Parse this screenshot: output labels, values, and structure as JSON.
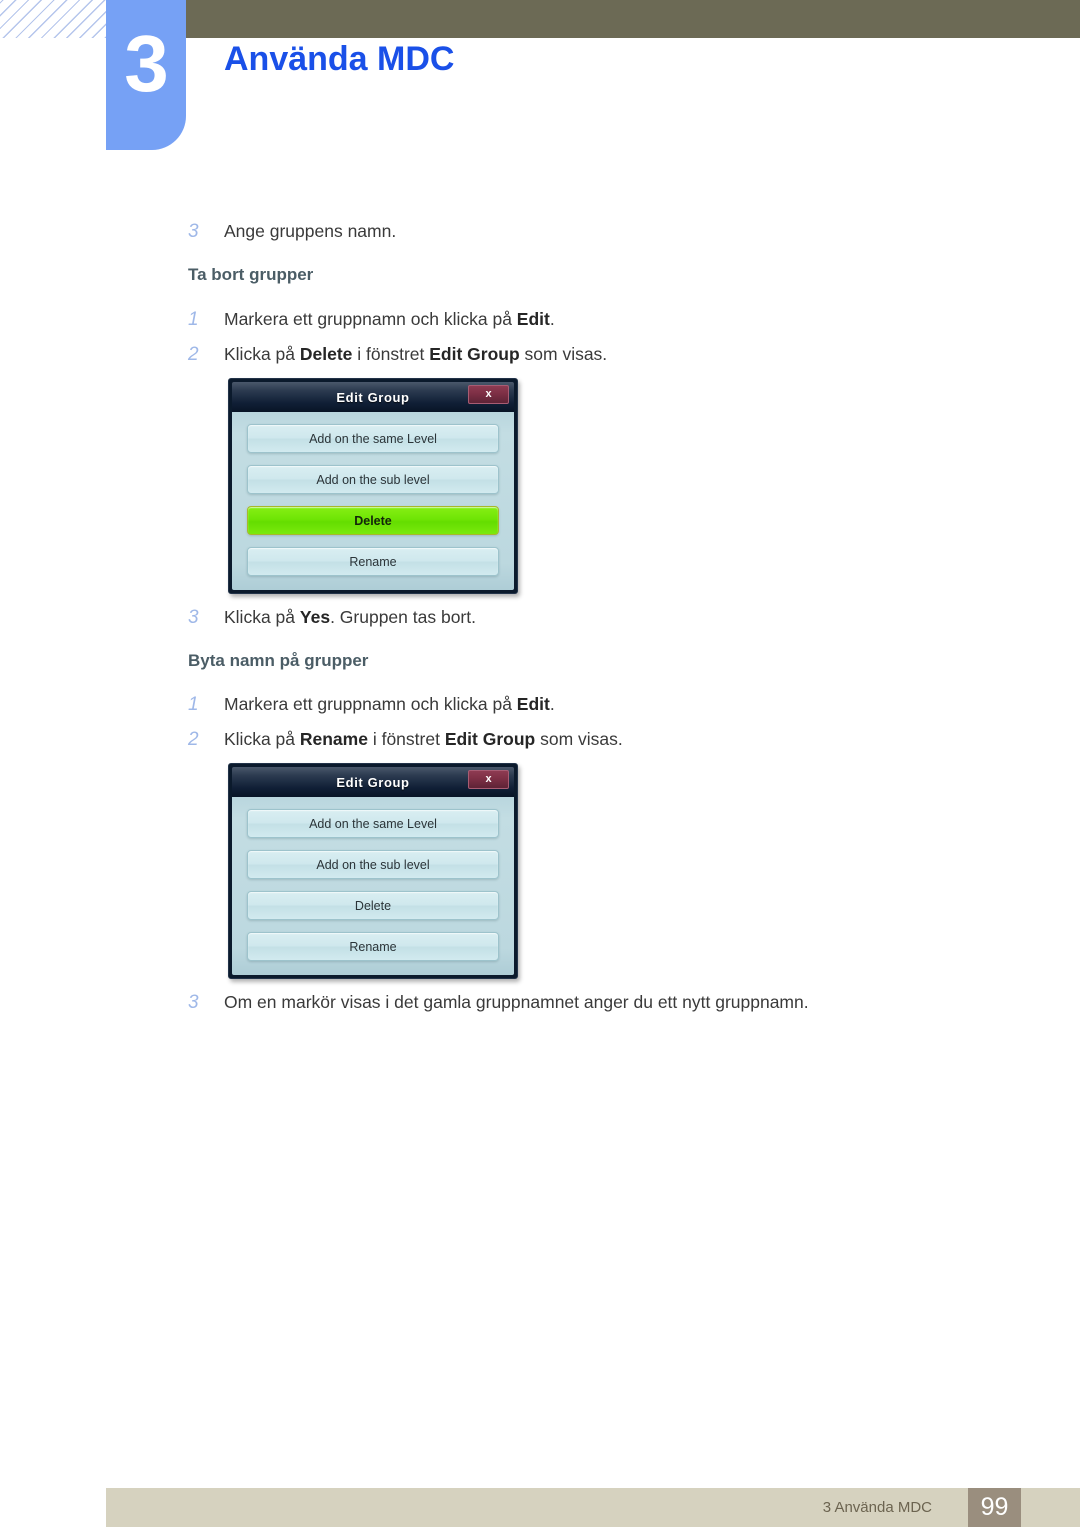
{
  "header": {
    "chapter_number": "3",
    "chapter_title": "Använda MDC",
    "hatch_icon": "diagonal-hatch-pattern",
    "accent_blue": "#76a1f5",
    "title_color": "#1a50e8",
    "bar_color": "#6c6a55"
  },
  "content": {
    "intro_step": {
      "num": "3",
      "text": "Ange gruppens namn."
    },
    "sections": [
      {
        "heading": "Ta bort grupper",
        "steps": [
          {
            "num": "1",
            "parts": [
              {
                "t": "Markera ett gruppnamn och klicka på ",
                "b": false
              },
              {
                "t": "Edit",
                "b": true
              },
              {
                "t": ".",
                "b": false
              }
            ]
          },
          {
            "num": "2",
            "parts": [
              {
                "t": "Klicka på ",
                "b": false
              },
              {
                "t": "Delete",
                "b": true
              },
              {
                "t": " i fönstret ",
                "b": false
              },
              {
                "t": "Edit Group",
                "b": true
              },
              {
                "t": " som visas.",
                "b": false
              }
            ]
          }
        ],
        "after_step": {
          "num": "3",
          "parts": [
            {
              "t": "Klicka på ",
              "b": false
            },
            {
              "t": "Yes",
              "b": true
            },
            {
              "t": ". Gruppen tas bort.",
              "b": false
            }
          ]
        }
      },
      {
        "heading": "Byta namn på grupper",
        "steps": [
          {
            "num": "1",
            "parts": [
              {
                "t": "Markera ett gruppnamn och klicka på ",
                "b": false
              },
              {
                "t": "Edit",
                "b": true
              },
              {
                "t": ".",
                "b": false
              }
            ]
          },
          {
            "num": "2",
            "parts": [
              {
                "t": "Klicka på ",
                "b": false
              },
              {
                "t": "Rename",
                "b": true
              },
              {
                "t": " i fönstret ",
                "b": false
              },
              {
                "t": "Edit Group",
                "b": true
              },
              {
                "t": " som visas.",
                "b": false
              }
            ]
          }
        ],
        "after_step": {
          "num": "3",
          "parts": [
            {
              "t": "Om en markör visas i det gamla gruppnamnet anger du ett nytt gruppnamn.",
              "b": false
            }
          ]
        }
      }
    ]
  },
  "dialogs": [
    {
      "title": "Edit Group",
      "close_label": "x",
      "buttons": [
        {
          "label": "Add on the same Level",
          "highlighted": false
        },
        {
          "label": "Add on the sub level",
          "highlighted": false
        },
        {
          "label": "Delete",
          "highlighted": true
        },
        {
          "label": "Rename",
          "highlighted": false
        }
      ],
      "highlight_color": "#6fe505"
    },
    {
      "title": "Edit Group",
      "close_label": "x",
      "buttons": [
        {
          "label": "Add on the same Level",
          "highlighted": false
        },
        {
          "label": "Add on the sub level",
          "highlighted": false
        },
        {
          "label": "Delete",
          "highlighted": false
        },
        {
          "label": "Rename",
          "highlighted": false
        }
      ],
      "highlight_color": "#6fe505"
    }
  ],
  "footer": {
    "label": "3 Använda MDC",
    "page_number": "99",
    "bar_color": "#d6d2bf",
    "page_box_color": "#9a8e7e"
  }
}
